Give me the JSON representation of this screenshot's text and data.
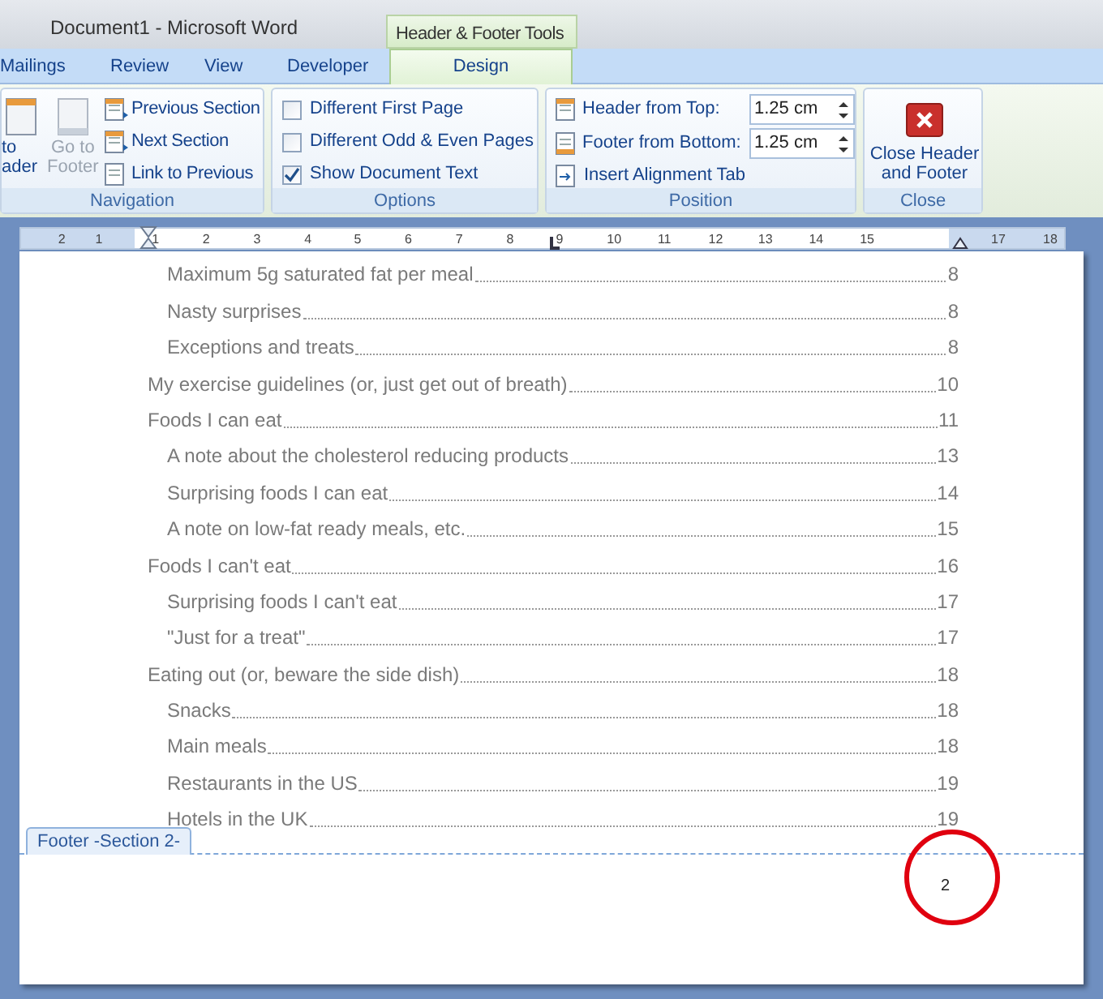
{
  "window": {
    "title": "Document1 - Microsoft Word",
    "context_tab": "Header & Footer Tools"
  },
  "tabs": [
    {
      "label": "Mailings",
      "selected": false
    },
    {
      "label": "Review",
      "selected": false
    },
    {
      "label": "View",
      "selected": false
    },
    {
      "label": "Developer",
      "selected": false
    },
    {
      "label": "Design",
      "selected": true
    }
  ],
  "navigation": {
    "title": "Navigation",
    "big_buttons": [
      {
        "lines": [
          "to",
          "ader"
        ],
        "disabled": false
      },
      {
        "lines": [
          "Go to",
          "Footer"
        ],
        "disabled": true
      }
    ],
    "items": [
      {
        "label": "Previous Section"
      },
      {
        "label": "Next Section"
      },
      {
        "label": "Link to Previous"
      }
    ]
  },
  "options": {
    "title": "Options",
    "checkboxes": [
      {
        "label": "Different First Page",
        "checked": false
      },
      {
        "label": "Different Odd & Even Pages",
        "checked": false
      },
      {
        "label": "Show Document Text",
        "checked": true
      }
    ]
  },
  "position": {
    "title": "Position",
    "fields": [
      {
        "label": "Header from Top:",
        "value": "1.25 cm"
      },
      {
        "label": "Footer from Bottom:",
        "value": "1.25 cm"
      }
    ],
    "insert_tab": "Insert Alignment Tab"
  },
  "close": {
    "title": "Close",
    "button": [
      "Close Header",
      "and Footer"
    ]
  },
  "ruler": [
    "2",
    "1",
    "1",
    "2",
    "3",
    "4",
    "5",
    "6",
    "7",
    "8",
    "9",
    "10",
    "11",
    "12",
    "13",
    "14",
    "15",
    "17",
    "18"
  ],
  "toc": [
    {
      "children": [
        {
          "title": "Maximum 5g saturated fat per meal",
          "page": "8"
        },
        {
          "title": "Nasty surprises",
          "page": "8"
        },
        {
          "title": "Exceptions and treats",
          "page": "8"
        }
      ]
    },
    {
      "title": "My exercise guidelines (or, just get out of breath)",
      "page": "10"
    },
    {
      "title": "Foods I can eat",
      "page": "11",
      "children": [
        {
          "title": "A note about the cholesterol reducing products",
          "page": "13"
        },
        {
          "title": "Surprising foods I can eat",
          "page": "14"
        },
        {
          "title": "A note on low-fat ready meals, etc.",
          "page": "15"
        }
      ]
    },
    {
      "title": "Foods I can't eat",
      "page": "16",
      "children": [
        {
          "title": "Surprising foods I can't eat",
          "page": "17"
        },
        {
          "title": "\"Just for a treat\"",
          "page": "17"
        }
      ]
    },
    {
      "title": "Eating out (or, beware the side dish)",
      "page": "18",
      "children": [
        {
          "title": "Snacks",
          "page": "18"
        },
        {
          "title": "Main meals",
          "page": "18"
        },
        {
          "title": "Restaurants in the US",
          "page": "19"
        },
        {
          "title": "Hotels in the UK",
          "page": "19"
        }
      ]
    }
  ],
  "footer": {
    "tab": "Footer -Section 2-",
    "page_number": "2"
  }
}
